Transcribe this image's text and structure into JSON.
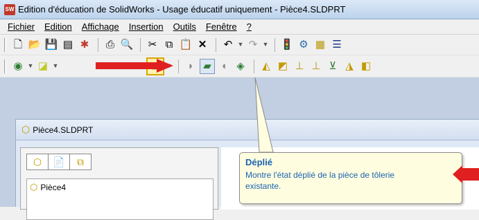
{
  "window": {
    "title": "Edition d'éducation de SolidWorks - Usage éducatif uniquement - Pièce4.SLDPRT",
    "app_icon_text": "SW"
  },
  "menu": {
    "items": [
      "Fichier",
      "Edition",
      "Affichage",
      "Insertion",
      "Outils",
      "Fenêtre",
      "?"
    ]
  },
  "toolbar1": {
    "icons": [
      "new-document-icon",
      "open-folder-icon",
      "save-icon",
      "print-preview-icon",
      "rebuild-icon",
      "print-icon",
      "zoom-preview-icon",
      "cut-icon",
      "copy-icon",
      "paste-icon",
      "delete-icon",
      "undo-icon",
      "redo-icon",
      "traffic-light-icon",
      "options-icon",
      "grid-icon",
      "list-icon"
    ]
  },
  "toolbar2": {
    "icons": [
      "sheet-metal-base-flange-icon",
      "sheet-metal-edge-icon",
      "flatten-icon",
      "bend-icon",
      "unfold-icon",
      "fold-icon",
      "no-bends-icon",
      "rip-icon",
      "hem-icon",
      "jog-icon",
      "sketched-bend-icon",
      "closed-corner-icon",
      "lofted-bend-icon",
      "insert-bends-icon"
    ],
    "highlight_color": "#d8a700",
    "arrow_color": "#e02020"
  },
  "document": {
    "title": "Pièce4.SLDPRT",
    "tree_root": "Pièce4"
  },
  "tooltip": {
    "title": "Déplié",
    "body": "Montre l'état déplié de la pièce de tôlerie existante.",
    "text_color": "#1a63b0"
  }
}
